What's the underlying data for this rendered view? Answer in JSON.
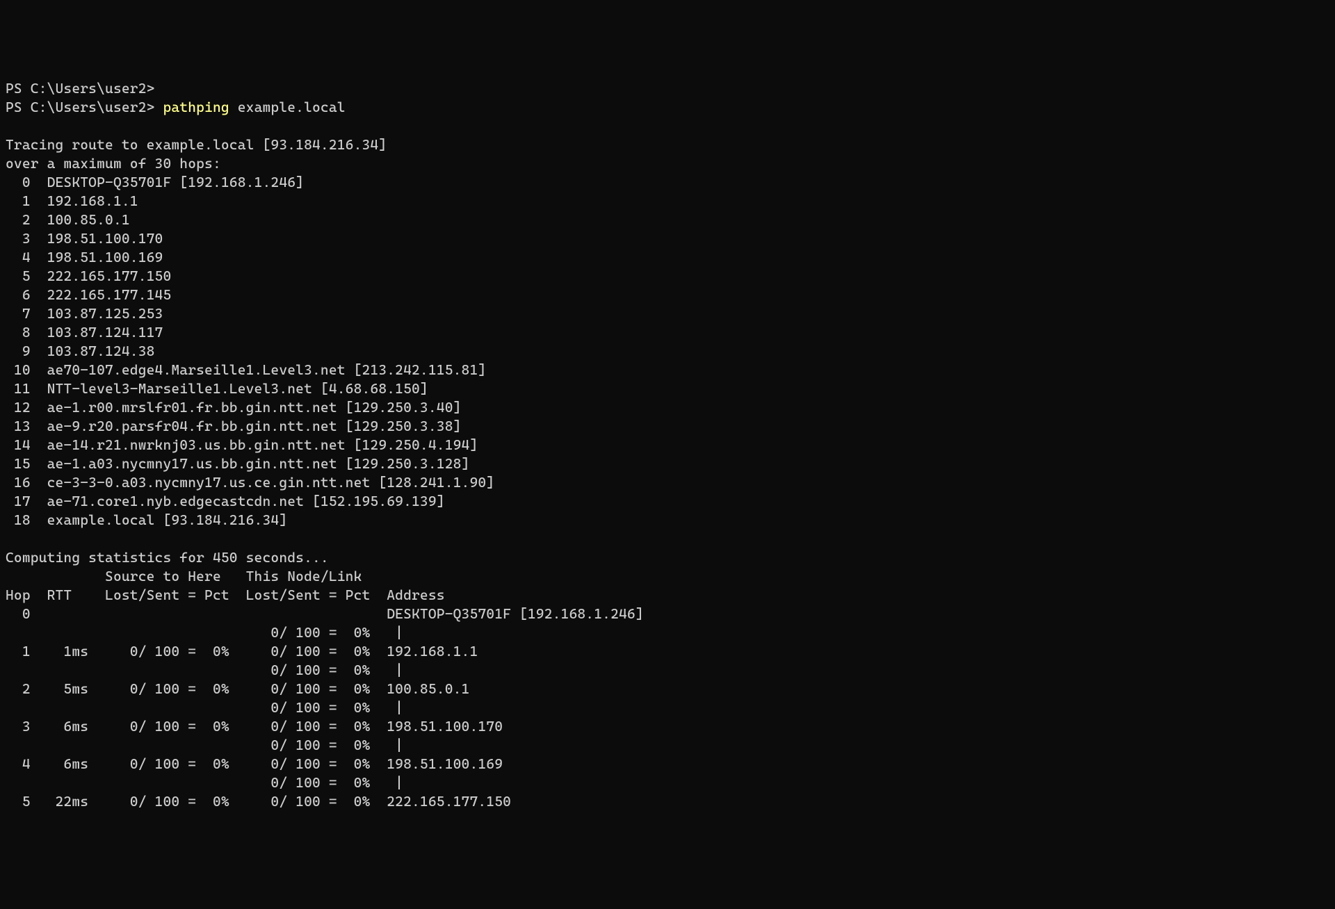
{
  "prompt_prefix": "PS C:\\Users\\user2>",
  "command": {
    "name": "pathping",
    "arg": "example.local"
  },
  "tracing_line": "Tracing route to example.local [93.184.216.34]",
  "hops_line": "over a maximum of 30 hops:",
  "route": [
    {
      "num": "0",
      "text": "DESKTOP-Q35701F [192.168.1.246]"
    },
    {
      "num": "1",
      "text": "192.168.1.1"
    },
    {
      "num": "2",
      "text": "100.85.0.1"
    },
    {
      "num": "3",
      "text": "198.51.100.170"
    },
    {
      "num": "4",
      "text": "198.51.100.169"
    },
    {
      "num": "5",
      "text": "222.165.177.150"
    },
    {
      "num": "6",
      "text": "222.165.177.145"
    },
    {
      "num": "7",
      "text": "103.87.125.253"
    },
    {
      "num": "8",
      "text": "103.87.124.117"
    },
    {
      "num": "9",
      "text": "103.87.124.38"
    },
    {
      "num": "10",
      "text": "ae70-107.edge4.Marseille1.Level3.net [213.242.115.81]"
    },
    {
      "num": "11",
      "text": "NTT-level3-Marseille1.Level3.net [4.68.68.150]"
    },
    {
      "num": "12",
      "text": "ae-1.r00.mrslfr01.fr.bb.gin.ntt.net [129.250.3.40]"
    },
    {
      "num": "13",
      "text": "ae-9.r20.parsfr04.fr.bb.gin.ntt.net [129.250.3.38]"
    },
    {
      "num": "14",
      "text": "ae-14.r21.nwrknj03.us.bb.gin.ntt.net [129.250.4.194]"
    },
    {
      "num": "15",
      "text": "ae-1.a03.nycmny17.us.bb.gin.ntt.net [129.250.3.128]"
    },
    {
      "num": "16",
      "text": "ce-3-3-0.a03.nycmny17.us.ce.gin.ntt.net [128.241.1.90]"
    },
    {
      "num": "17",
      "text": "ae-71.core1.nyb.edgecastcdn.net [152.195.69.139]"
    },
    {
      "num": "18",
      "text": "example.local [93.184.216.34]"
    }
  ],
  "computing_line": "Computing statistics for 450 seconds...",
  "stats_header1": "            Source to Here   This Node/Link",
  "stats_header2": "Hop  RTT    Lost/Sent = Pct  Lost/Sent = Pct  Address",
  "stats": [
    {
      "line": "  0                                           DESKTOP-Q35701F [192.168.1.246]"
    },
    {
      "line": "                                0/ 100 =  0%   |"
    },
    {
      "line": "  1    1ms     0/ 100 =  0%     0/ 100 =  0%  192.168.1.1"
    },
    {
      "line": "                                0/ 100 =  0%   |"
    },
    {
      "line": "  2    5ms     0/ 100 =  0%     0/ 100 =  0%  100.85.0.1"
    },
    {
      "line": "                                0/ 100 =  0%   |"
    },
    {
      "line": "  3    6ms     0/ 100 =  0%     0/ 100 =  0%  198.51.100.170"
    },
    {
      "line": "                                0/ 100 =  0%   |"
    },
    {
      "line": "  4    6ms     0/ 100 =  0%     0/ 100 =  0%  198.51.100.169"
    },
    {
      "line": "                                0/ 100 =  0%   |"
    },
    {
      "line": "  5   22ms     0/ 100 =  0%     0/ 100 =  0%  222.165.177.150"
    }
  ]
}
